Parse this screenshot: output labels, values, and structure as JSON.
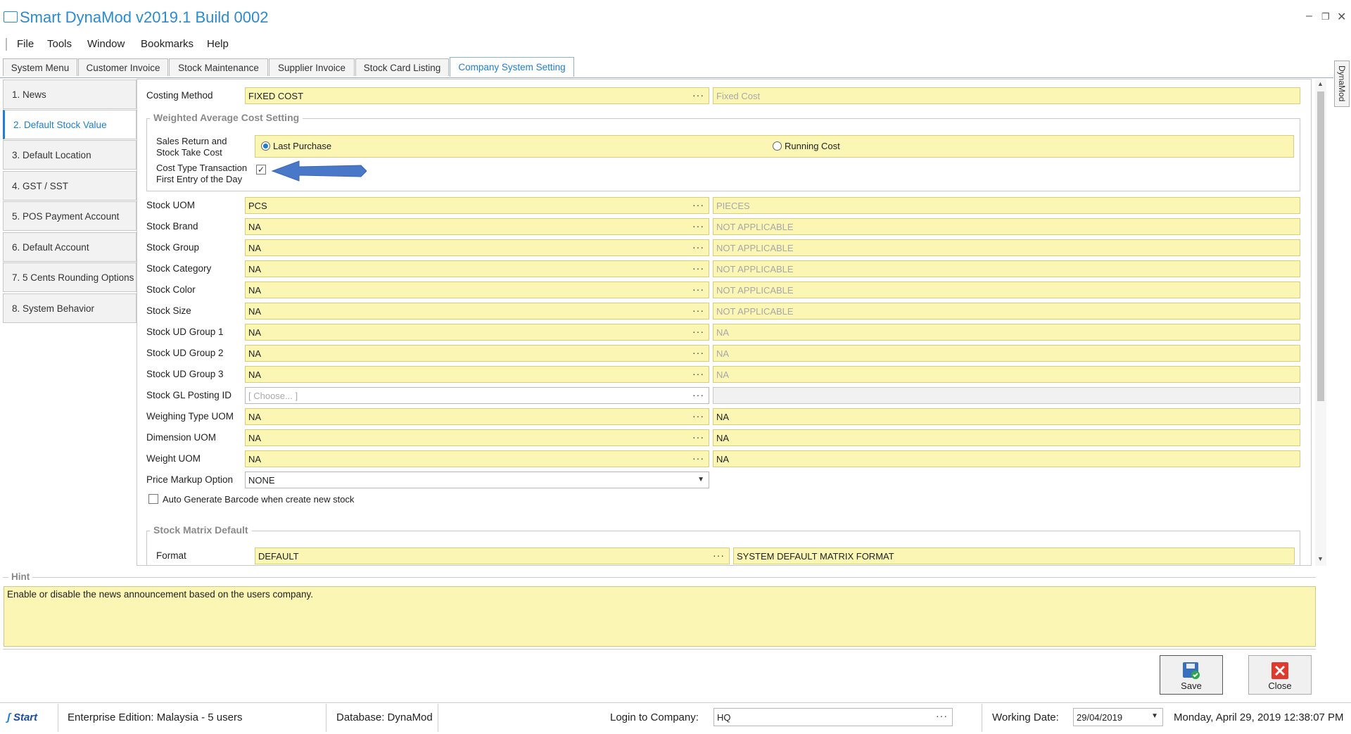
{
  "window": {
    "title": "Smart DynaMod v2019.1 Build 0002"
  },
  "menu": [
    "File",
    "Tools",
    "Window",
    "Bookmarks",
    "Help"
  ],
  "tabs": [
    "System Menu",
    "Customer Invoice",
    "Stock Maintenance",
    "Supplier Invoice",
    "Stock Card Listing",
    "Company System Setting"
  ],
  "side_tab": "DynaMod",
  "nav": [
    "1. News",
    "2. Default Stock Value",
    "3. Default Location",
    "4. GST / SST",
    "5. POS Payment Account",
    "6. Default Account",
    "7. 5 Cents Rounding Options",
    "8. System Behavior"
  ],
  "form": {
    "costing": {
      "label": "Costing Method",
      "code": "FIXED COST",
      "desc": "Fixed Cost"
    },
    "wac_group": {
      "title": "Weighted Average Cost Setting",
      "sales_return_label_1": "Sales Return and",
      "sales_return_label_2": "Stock Take Cost",
      "option_last_purchase": "Last Purchase",
      "option_running_cost": "Running Cost",
      "cost_type_label_1": "Cost Type Transaction",
      "cost_type_label_2": "First Entry of the Day",
      "cost_type_checked": true
    },
    "rows": [
      {
        "label": "Stock UOM",
        "code": "PCS",
        "desc": "PIECES"
      },
      {
        "label": "Stock Brand",
        "code": "NA",
        "desc": "NOT APPLICABLE"
      },
      {
        "label": "Stock Group",
        "code": "NA",
        "desc": "NOT APPLICABLE"
      },
      {
        "label": "Stock Category",
        "code": "NA",
        "desc": "NOT APPLICABLE"
      },
      {
        "label": "Stock Color",
        "code": "NA",
        "desc": "NOT APPLICABLE"
      },
      {
        "label": "Stock Size",
        "code": "NA",
        "desc": "NOT APPLICABLE"
      },
      {
        "label": "Stock UD Group 1",
        "code": "NA",
        "desc": "NA"
      },
      {
        "label": "Stock UD Group 2",
        "code": "NA",
        "desc": "NA"
      },
      {
        "label": "Stock UD Group 3",
        "code": "NA",
        "desc": "NA"
      },
      {
        "label": "Stock GL Posting ID",
        "code": "[ Choose... ]",
        "desc": ""
      },
      {
        "label": "Weighing Type UOM",
        "code": "NA",
        "desc": "NA"
      },
      {
        "label": "Dimension UOM",
        "code": "NA",
        "desc": "NA"
      },
      {
        "label": "Weight UOM",
        "code": "NA",
        "desc": "NA"
      }
    ],
    "price_markup": {
      "label": "Price Markup Option",
      "value": "NONE"
    },
    "auto_barcode": {
      "label": "Auto Generate Barcode when create new stock",
      "checked": false
    },
    "matrix_group": {
      "title": "Stock Matrix Default",
      "format_label": "Format",
      "format_code": "DEFAULT",
      "format_desc": "SYSTEM DEFAULT MATRIX FORMAT"
    }
  },
  "hint": {
    "title": "Hint",
    "text": "Enable or disable the news announcement based on the users company."
  },
  "buttons": {
    "save": "Save",
    "close": "Close"
  },
  "status": {
    "start": "Start",
    "edition": "Enterprise Edition: Malaysia - 5 users",
    "database": "Database: DynaMod",
    "login_label": "Login to Company:",
    "login_value": "HQ",
    "working_date_label": "Working Date:",
    "working_date": "29/04/2019",
    "datetime": "Monday, April 29, 2019 12:38:07 PM"
  },
  "colors": {
    "accent": "#1e7ed0",
    "field_yellow": "#fbf6b4",
    "arrow_blue": "#4a78c8"
  }
}
